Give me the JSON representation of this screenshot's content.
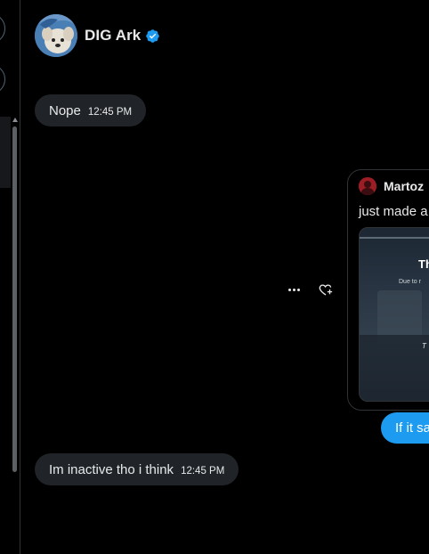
{
  "header": {
    "name": "DIG Ark",
    "verified_color": "#1d9bf0"
  },
  "messages": [
    {
      "direction": "incoming",
      "text": "Nope",
      "time": "12:45 PM"
    },
    {
      "direction": "incoming",
      "text": "Im inactive tho i think",
      "time": "12:45 PM"
    }
  ],
  "shared_post": {
    "author": "Martoz",
    "text": "just made a",
    "media": {
      "title": "Th",
      "subtitle": "Due to r",
      "caption": "T"
    }
  },
  "outgoing": {
    "text": "If it sa",
    "color": "#1d9bf0"
  },
  "icons": {
    "more": "more-horizontal-icon",
    "react": "add-reaction-icon",
    "verified": "verified-badge-icon"
  }
}
